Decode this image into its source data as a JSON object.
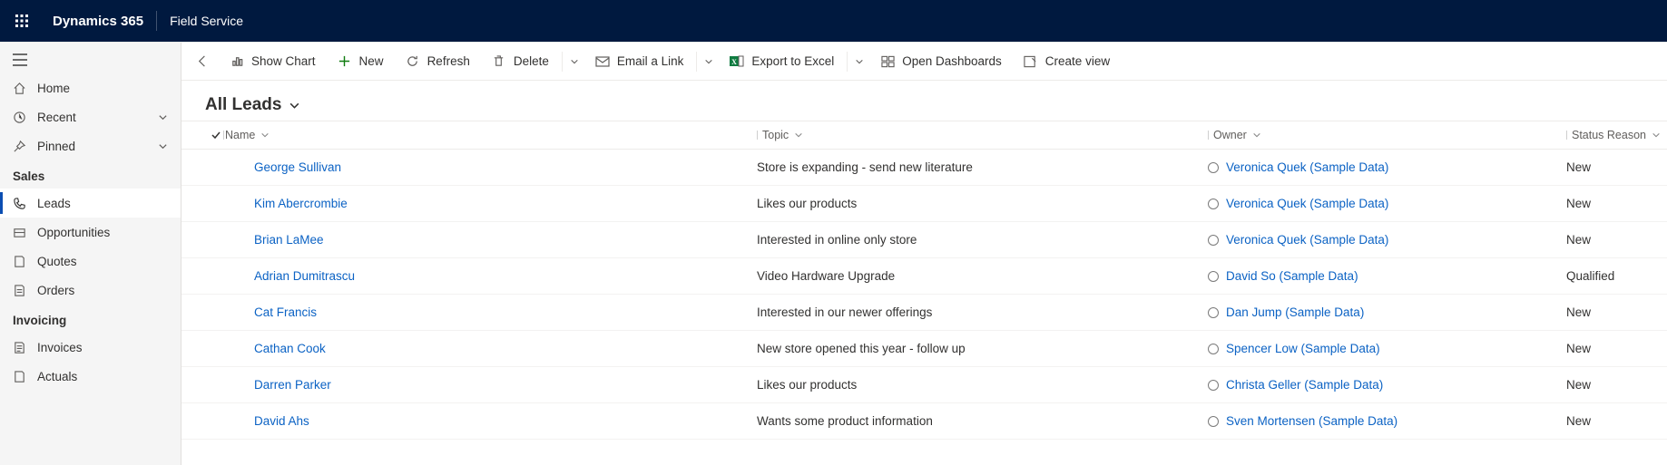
{
  "topbar": {
    "brand": "Dynamics 365",
    "app": "Field Service"
  },
  "sidebar": {
    "home": "Home",
    "recent": "Recent",
    "pinned": "Pinned",
    "section_sales": "Sales",
    "leads": "Leads",
    "opportunities": "Opportunities",
    "quotes": "Quotes",
    "orders": "Orders",
    "section_invoicing": "Invoicing",
    "invoices": "Invoices",
    "actuals": "Actuals"
  },
  "commands": {
    "show_chart": "Show Chart",
    "new": "New",
    "refresh": "Refresh",
    "delete": "Delete",
    "email_link": "Email a Link",
    "export_excel": "Export to Excel",
    "open_dashboards": "Open Dashboards",
    "create_view": "Create view"
  },
  "view": {
    "title": "All Leads"
  },
  "columns": {
    "name": "Name",
    "topic": "Topic",
    "owner": "Owner",
    "status": "Status Reason"
  },
  "rows": [
    {
      "name": "George Sullivan",
      "topic": "Store is expanding - send new literature",
      "owner": "Veronica Quek (Sample Data)",
      "status": "New"
    },
    {
      "name": "Kim Abercrombie",
      "topic": "Likes our products",
      "owner": "Veronica Quek (Sample Data)",
      "status": "New"
    },
    {
      "name": "Brian LaMee",
      "topic": "Interested in online only store",
      "owner": "Veronica Quek (Sample Data)",
      "status": "New"
    },
    {
      "name": "Adrian Dumitrascu",
      "topic": "Video Hardware Upgrade",
      "owner": "David So (Sample Data)",
      "status": "Qualified"
    },
    {
      "name": "Cat Francis",
      "topic": "Interested in our newer offerings",
      "owner": "Dan Jump (Sample Data)",
      "status": "New"
    },
    {
      "name": "Cathan Cook",
      "topic": "New store opened this year - follow up",
      "owner": "Spencer Low (Sample Data)",
      "status": "New"
    },
    {
      "name": "Darren Parker",
      "topic": "Likes our products",
      "owner": "Christa Geller (Sample Data)",
      "status": "New"
    },
    {
      "name": "David Ahs",
      "topic": "Wants some product information",
      "owner": "Sven Mortensen (Sample Data)",
      "status": "New"
    }
  ]
}
